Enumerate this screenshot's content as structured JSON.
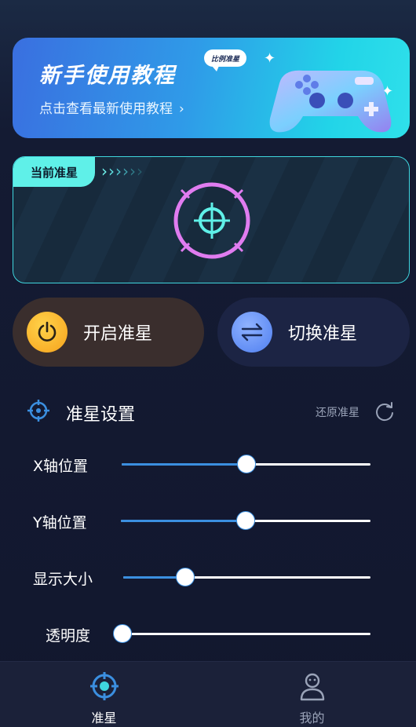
{
  "banner": {
    "title": "新手使用教程",
    "bubble": "比例准星",
    "subtitle": "点击查看最新使用教程",
    "chevron": "›"
  },
  "crosshair_card": {
    "tag": "当前准星",
    "color": "#e07cf0",
    "accent": "#3fd6de"
  },
  "actions": {
    "enable_label": "开启准星",
    "switch_label": "切换准星"
  },
  "settings": {
    "title": "准星设置",
    "reset_label": "还原准星",
    "sliders": [
      {
        "label": "X轴位置",
        "value": 0.5
      },
      {
        "label": "Y轴位置",
        "value": 0.5
      },
      {
        "label": "显示大小",
        "value": 0.25
      },
      {
        "label": "透明度",
        "value": 0.0
      }
    ]
  },
  "tabbar": {
    "tabs": [
      {
        "label": "准星",
        "icon": "crosshair-icon",
        "active": true,
        "color": "#ffffff"
      },
      {
        "label": "我的",
        "icon": "user-icon",
        "active": false,
        "color": "#9aa3b8"
      }
    ]
  },
  "colors": {
    "slider_fill": "#3b8fe0",
    "enable_circle": "#f6b024",
    "switch_circle": "#5f8df5"
  }
}
